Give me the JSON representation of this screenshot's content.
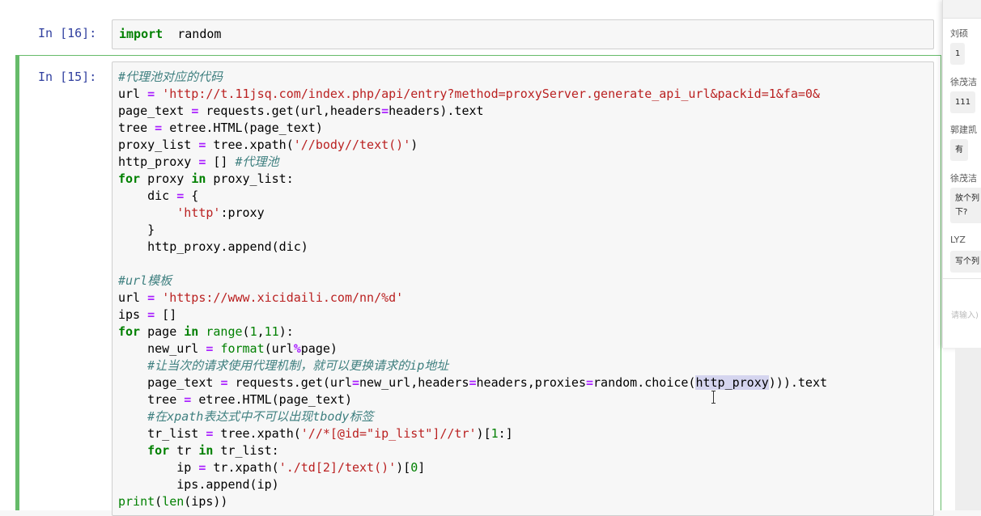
{
  "cells": [
    {
      "prompt": "In [16]:",
      "lines": [
        [
          [
            "kw",
            "import"
          ],
          [
            "",
            "  random"
          ]
        ]
      ]
    },
    {
      "prompt": "In [15]:",
      "lines": [
        [
          [
            "cm",
            "#代理池对应的代码"
          ]
        ],
        [
          [
            "",
            "url "
          ],
          [
            "op",
            "="
          ],
          [
            "",
            " "
          ],
          [
            "st",
            "'http://t.11jsq.com/index.php/api/entry?method=proxyServer.generate_api_url&packid=1&fa=0&"
          ]
        ],
        [
          [
            "",
            "page_text "
          ],
          [
            "op",
            "="
          ],
          [
            "",
            " requests.get(url,headers"
          ],
          [
            "op",
            "="
          ],
          [
            "",
            "headers).text"
          ]
        ],
        [
          [
            "",
            "tree "
          ],
          [
            "op",
            "="
          ],
          [
            "",
            " etree.HTML(page_text)"
          ]
        ],
        [
          [
            "",
            "proxy_list "
          ],
          [
            "op",
            "="
          ],
          [
            "",
            " tree.xpath("
          ],
          [
            "st",
            "'//body//text()'"
          ],
          [
            "",
            ")"
          ]
        ],
        [
          [
            "",
            "http_proxy "
          ],
          [
            "op",
            "="
          ],
          [
            "",
            " [] "
          ],
          [
            "cm",
            "#代理池"
          ]
        ],
        [
          [
            "kw",
            "for"
          ],
          [
            "",
            " proxy "
          ],
          [
            "kw",
            "in"
          ],
          [
            "",
            " proxy_list:"
          ]
        ],
        [
          [
            "",
            "    dic "
          ],
          [
            "op",
            "="
          ],
          [
            "",
            " {"
          ]
        ],
        [
          [
            "",
            "        "
          ],
          [
            "st",
            "'http'"
          ],
          [
            "",
            ":proxy"
          ]
        ],
        [
          [
            "",
            "    }"
          ]
        ],
        [
          [
            "",
            "    http_proxy.append(dic)"
          ]
        ],
        [
          [
            "",
            ""
          ]
        ],
        [
          [
            "cm",
            "#url模板"
          ]
        ],
        [
          [
            "",
            "url "
          ],
          [
            "op",
            "="
          ],
          [
            "",
            " "
          ],
          [
            "st",
            "'https://www.xicidaili.com/nn/%d'"
          ]
        ],
        [
          [
            "",
            "ips "
          ],
          [
            "op",
            "="
          ],
          [
            "",
            " []"
          ]
        ],
        [
          [
            "kw",
            "for"
          ],
          [
            "",
            " page "
          ],
          [
            "kw",
            "in"
          ],
          [
            "",
            " "
          ],
          [
            "bi",
            "range"
          ],
          [
            "",
            "("
          ],
          [
            "nu",
            "1"
          ],
          [
            "",
            ","
          ],
          [
            "nu",
            "11"
          ],
          [
            "",
            "):"
          ]
        ],
        [
          [
            "",
            "    new_url "
          ],
          [
            "op",
            "="
          ],
          [
            "",
            " "
          ],
          [
            "bi",
            "format"
          ],
          [
            "",
            "(url"
          ],
          [
            "op",
            "%"
          ],
          [
            "",
            "page)"
          ]
        ],
        [
          [
            "",
            "    "
          ],
          [
            "cm",
            "#让当次的请求使用代理机制，就可以更换请求的ip地址"
          ]
        ],
        [
          [
            "",
            "    page_text "
          ],
          [
            "op",
            "="
          ],
          [
            "",
            " requests.get(url"
          ],
          [
            "op",
            "="
          ],
          [
            "",
            "new_url,headers"
          ],
          [
            "op",
            "="
          ],
          [
            "",
            "headers,proxies"
          ],
          [
            "op",
            "="
          ],
          [
            "",
            "random.choice("
          ],
          [
            "hl",
            "http_proxy"
          ],
          [
            "",
            "))).text"
          ]
        ],
        [
          [
            "",
            "    tree "
          ],
          [
            "op",
            "="
          ],
          [
            "",
            " etree.HTML(page_text)"
          ]
        ],
        [
          [
            "",
            "    "
          ],
          [
            "cm",
            "#在xpath表达式中不可以出现tbody标签"
          ]
        ],
        [
          [
            "",
            "    tr_list "
          ],
          [
            "op",
            "="
          ],
          [
            "",
            " tree.xpath("
          ],
          [
            "st",
            "'//*[@id=\"ip_list\"]//tr'"
          ],
          [
            ")",
            ")"
          ],
          [
            "",
            "["
          ],
          [
            "nu",
            "1"
          ],
          [
            "",
            ":]"
          ]
        ],
        [
          [
            "",
            "    "
          ],
          [
            "kw",
            "for"
          ],
          [
            "",
            " tr "
          ],
          [
            "kw",
            "in"
          ],
          [
            "",
            " tr_list:"
          ]
        ],
        [
          [
            "",
            "        ip "
          ],
          [
            "op",
            "="
          ],
          [
            "",
            " tr.xpath("
          ],
          [
            "st",
            "'./td[2]/text()'"
          ],
          [
            "",
            ")["
          ],
          [
            "nu",
            "0"
          ],
          [
            "",
            "]"
          ]
        ],
        [
          [
            "",
            "        ips.append(ip)"
          ]
        ],
        [
          [
            "bi",
            "print"
          ],
          [
            "",
            "("
          ],
          [
            "bi",
            "len"
          ],
          [
            "",
            "(ips))"
          ]
        ]
      ]
    }
  ],
  "chat": {
    "messages": [
      {
        "name": "刘硕",
        "text": "1"
      },
      {
        "name": "徐茂洁",
        "text": "111"
      },
      {
        "name": "郭建凯",
        "text": "有"
      },
      {
        "name": "徐茂洁",
        "text": "放个列\n下?"
      },
      {
        "name": "LYZ",
        "text": "写个列"
      }
    ],
    "input_placeholder": "请输入)"
  },
  "colors": {
    "keyword": "#008000",
    "string": "#ba2121",
    "comment": "#408080",
    "operator": "#aa22ff",
    "prompt": "#303f9f",
    "selected_cell_border": "#66bb6a"
  }
}
